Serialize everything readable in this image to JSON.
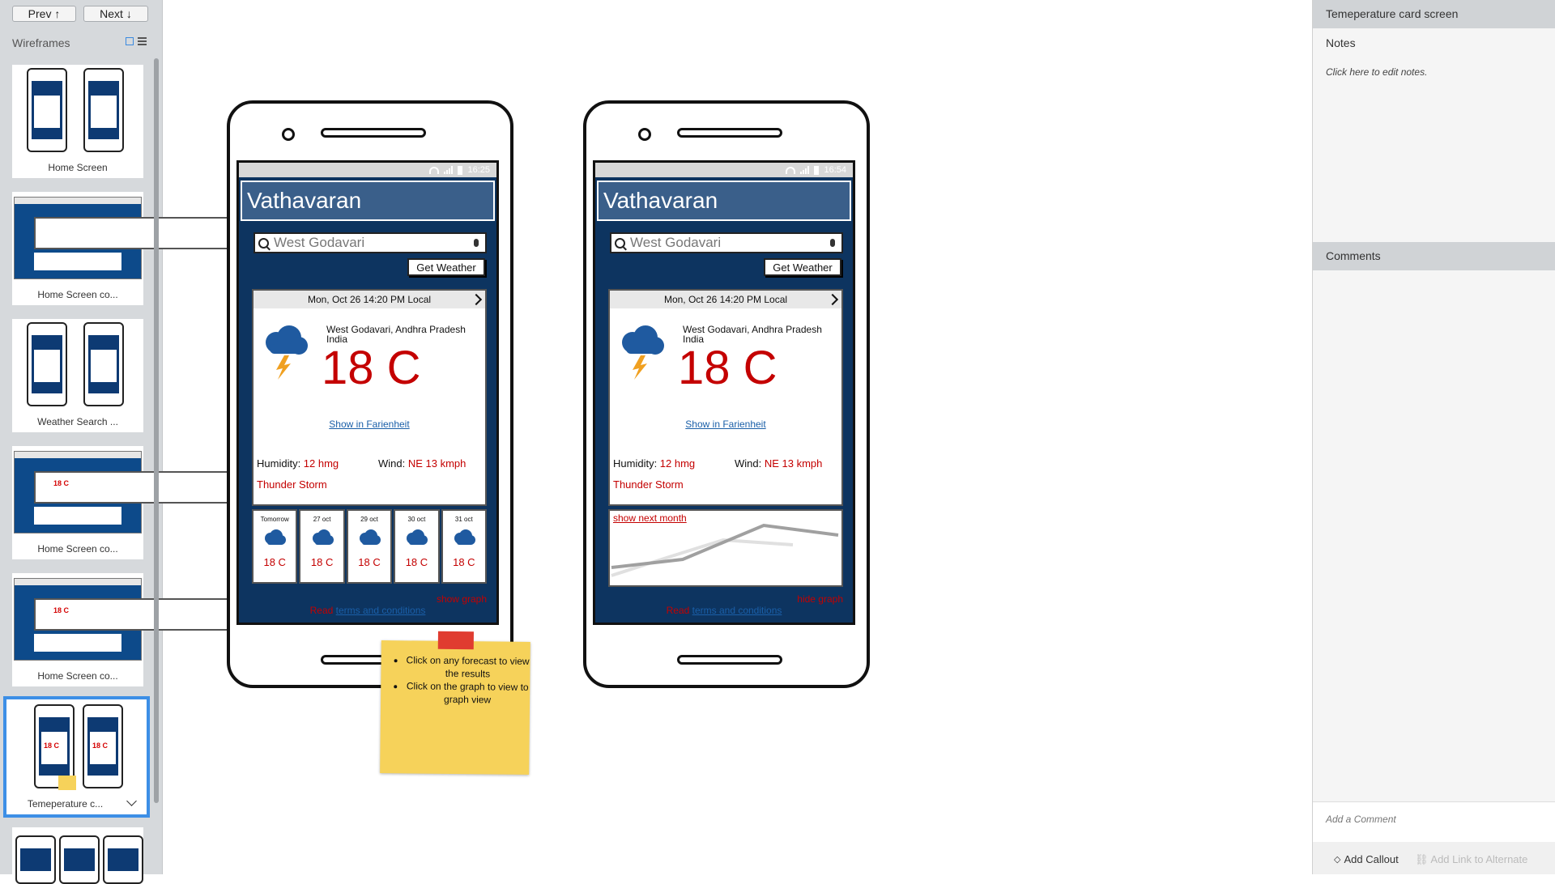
{
  "nav": {
    "prev_label": "Prev ↑",
    "next_label": "Next ↓",
    "wireframes_title": "Wireframes"
  },
  "thumbs": [
    {
      "label": "Home Screen",
      "temp": ""
    },
    {
      "label": "Home Screen co...",
      "temp": ""
    },
    {
      "label": "Weather Search ...",
      "temp": ""
    },
    {
      "label": "Home Screen co...",
      "temp": "18 C"
    },
    {
      "label": "Home Screen co...",
      "temp": "18 C"
    },
    {
      "label": "Temeperature c...",
      "temp": "18 C"
    }
  ],
  "phones": [
    {
      "time": "16:25",
      "app_title": "Vathavaran",
      "search_value": "West Godavari",
      "get_weather": "Get Weather",
      "datetime": "Mon, Oct 26 14:20 PM Local",
      "location_line1": "West Godavari, Andhra Pradesh",
      "location_line2": "India",
      "temperature": "18 C",
      "fahrenheit_link": "Show in Farienheit",
      "humidity_label": "Humidity: ",
      "humidity_value": "12 hmg",
      "wind_label": "Wind: ",
      "wind_value": "NE 13 kmph",
      "condition": "Thunder Storm",
      "toggle_graph": "show graph",
      "terms_prefix": "Read ",
      "terms_link": "terms and conditions",
      "forecast": [
        {
          "day": "Tomorrow",
          "temp": "18 C"
        },
        {
          "day": "27 oct",
          "temp": "18 C"
        },
        {
          "day": "29 oct",
          "temp": "18 C"
        },
        {
          "day": "30 oct",
          "temp": "18 C"
        },
        {
          "day": "31 oct",
          "temp": "18 C"
        }
      ]
    },
    {
      "time": "16:54",
      "app_title": "Vathavaran",
      "search_value": "West Godavari",
      "get_weather": "Get Weather",
      "datetime": "Mon, Oct 26 14:20 PM Local",
      "location_line1": "West Godavari, Andhra Pradesh",
      "location_line2": "India",
      "temperature": "18 C",
      "fahrenheit_link": "Show in Farienheit",
      "humidity_label": "Humidity: ",
      "humidity_value": "12 hmg",
      "wind_label": "Wind: ",
      "wind_value": "NE 13 kmph",
      "condition": "Thunder Storm",
      "graph_link": "show next month",
      "toggle_graph": "hide graph",
      "terms_prefix": "Read ",
      "terms_link": "terms and conditions"
    }
  ],
  "sticky_note": {
    "items": [
      "Click on any forecast to view the results",
      "Click on the graph to view to graph view"
    ]
  },
  "right_panel": {
    "screen_title": "Temeperature card screen",
    "notes_label": "Notes",
    "notes_placeholder": "Click here to edit notes.",
    "comments_label": "Comments",
    "add_comment": "Add a Comment",
    "add_callout": "Add Callout",
    "add_link": "Add Link to Alternate"
  },
  "colors": {
    "accent": "#3d8fe6",
    "phone_screen": "#0d3460",
    "title_bar": "#3a5f8a",
    "temp_red": "#c40000",
    "sticky": "#f6d25a"
  }
}
